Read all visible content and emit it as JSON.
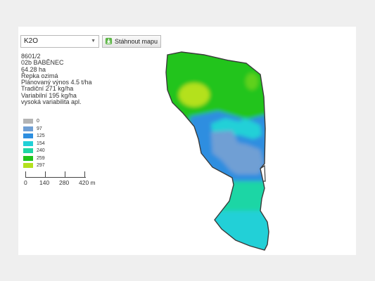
{
  "toolbar": {
    "nutrient_select": "K2O",
    "download_label": "Stáhnout mapu"
  },
  "field_info": {
    "id": "8601/2",
    "name": "02b BABĚNEC",
    "area": "64.28 ha",
    "crop": "Řepka ozimá",
    "yield": "Plánovaný výnos 4.5 t/ha",
    "traditional": "Tradiční 271 kg/ha",
    "variable": "Variabilní 195 kg/ha",
    "variability": "vysoká variabilita apl."
  },
  "legend": [
    {
      "label": "0",
      "color": "#b4b4b4"
    },
    {
      "label": "97",
      "color": "#6f9fd4"
    },
    {
      "label": "125",
      "color": "#2d8ee0"
    },
    {
      "label": "154",
      "color": "#21d0d7"
    },
    {
      "label": "240",
      "color": "#1ed6a5"
    },
    {
      "label": "259",
      "color": "#22c41b"
    },
    {
      "label": "297",
      "color": "#b4e11e"
    }
  ],
  "scale": {
    "labels": [
      "0",
      "140",
      "280",
      "420 m"
    ]
  }
}
